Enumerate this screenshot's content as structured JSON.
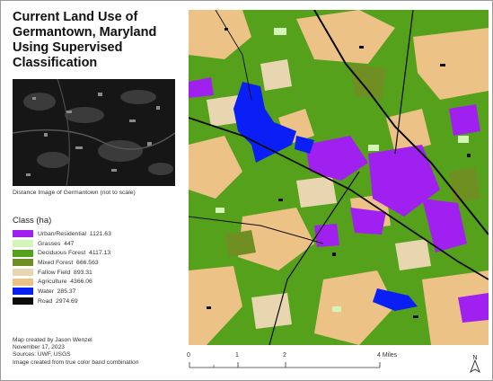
{
  "map_title": "Current Land Use of Germantown, Maryland Using Supervised Classification",
  "inset": {
    "caption": "Distance Image of Germantown (not to scale)"
  },
  "legend": {
    "title": "Class (ha)",
    "items": [
      {
        "label": "Urban/Residential  1121.63",
        "color": "#a020f0"
      },
      {
        "label": "Grasses  447",
        "color": "#d4f5b8"
      },
      {
        "label": "Deciduous Forest  4117.13",
        "color": "#56a11c"
      },
      {
        "label": "Mixed Forest  666.563",
        "color": "#6f8f22"
      },
      {
        "label": "Fallow Field  893.31",
        "color": "#e8d6b0"
      },
      {
        "label": "Agriculture  4366.06",
        "color": "#edc287"
      },
      {
        "label": "Water  285.37",
        "color": "#0a1ff5"
      },
      {
        "label": "Road  2974.69",
        "color": "#0a0a0a"
      }
    ]
  },
  "credits": {
    "line1": "Map created by Jason Wenzel",
    "line2": "November 17, 2023",
    "line3": "Sources:  UWF, USGS",
    "line4": "Image created from true color band combination"
  },
  "scale": {
    "labels": [
      "0",
      "1",
      "2",
      "4 Miles"
    ]
  },
  "north_label": "N"
}
